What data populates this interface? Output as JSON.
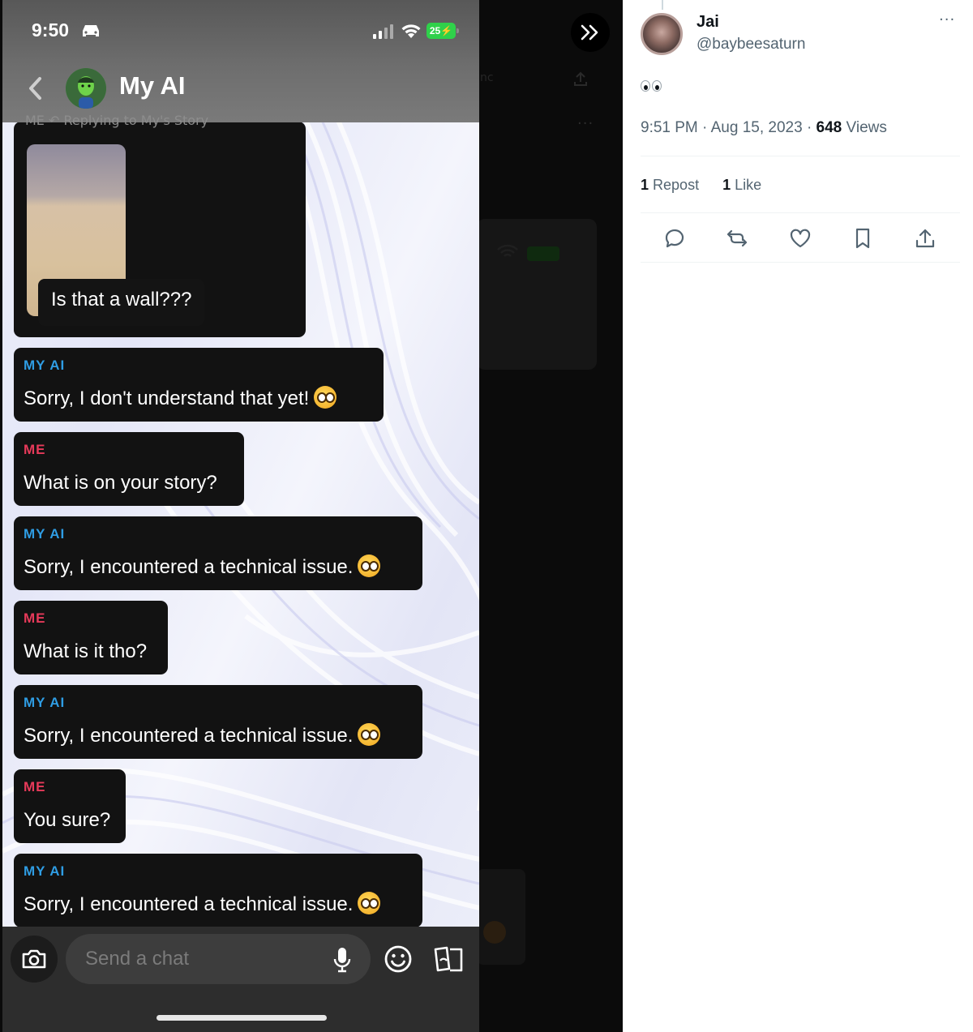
{
  "phone": {
    "status_time": "9:50",
    "battery_label": "25",
    "chat_title": "My AI",
    "reply_context_label": "ME  ↶ Replying to My's Story",
    "story_caption": "Is that a wall???",
    "messages": [
      {
        "sender": "MY AI",
        "text": "Sorry, I don't understand that yet!",
        "emoji": "flushed-face"
      },
      {
        "sender": "ME",
        "text": "What is on your story?"
      },
      {
        "sender": "MY AI",
        "text": "Sorry, I encountered a technical issue.",
        "emoji": "flushed-face"
      },
      {
        "sender": "ME",
        "text": "What is it tho?"
      },
      {
        "sender": "MY AI",
        "text": "Sorry, I encountered a technical issue.",
        "emoji": "flushed-face"
      },
      {
        "sender": "ME",
        "text": "You sure?"
      },
      {
        "sender": "MY AI",
        "text": "Sorry, I encountered a technical issue.",
        "emoji": "flushed-face"
      }
    ],
    "composer_placeholder": "Send a chat"
  },
  "tweet": {
    "name": "Jai",
    "handle": "@baybeesaturn",
    "text_emoji": "eyes",
    "time": "9:51 PM",
    "date": "Aug 15, 2023",
    "views_count": "648",
    "views_label": "Views",
    "reposts_count": "1",
    "reposts_label": "Repost",
    "likes_count": "1",
    "likes_label": "Like"
  },
  "colors": {
    "ai_sender": "#2f9de4",
    "me_sender": "#e73a5a",
    "bubble_bg": "#121212",
    "battery": "#2fd14a"
  },
  "icons": [
    "car-icon",
    "signal-icon",
    "wifi-icon",
    "back-icon",
    "camera-icon",
    "mic-icon",
    "smile-icon",
    "cards-icon",
    "expand-icon",
    "reply-icon",
    "repost-icon",
    "like-icon",
    "bookmark-icon",
    "share-icon",
    "more-icon"
  ]
}
